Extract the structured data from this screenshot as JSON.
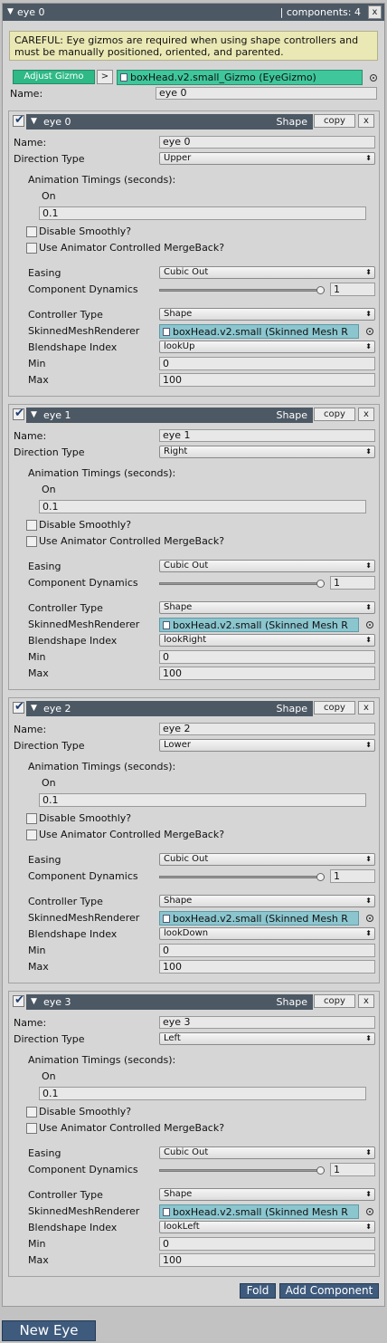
{
  "header": {
    "title": "eye 0",
    "components_label": "| components: 4",
    "close_glyph": "x"
  },
  "warning": {
    "line1": "CAREFUL: Eye gizmos are required when using shape controllers and",
    "line2": "must be manually positioned, oriented, and parented."
  },
  "gizmo": {
    "adjust_label": "Adjust Gizmo",
    "arrow_label": ">",
    "object_value": "boxHead.v2.small_Gizmo (EyeGizmo)"
  },
  "top_name": {
    "label": "Name:",
    "value": "eye 0"
  },
  "labels": {
    "name": "Name:",
    "direction": "Direction Type",
    "timings": "Animation Timings (seconds):",
    "on": "On",
    "disable_smoothly": "Disable Smoothly?",
    "use_animator": "Use Animator Controlled MergeBack?",
    "easing": "Easing",
    "dynamics": "Component Dynamics",
    "controller_type": "Controller Type",
    "smr": "SkinnedMeshRenderer",
    "blendshape": "Blendshape Index",
    "min": "Min",
    "max": "Max",
    "shape": "Shape",
    "copy": "copy",
    "x": "x"
  },
  "eyes": [
    {
      "title": "eye 0",
      "name": "eye 0",
      "direction": "Upper",
      "on": "0.1",
      "easing": "Cubic Out",
      "dynamics": "1",
      "dynamics_level": 1.0,
      "controller": "Shape",
      "smr": "boxHead.v2.small (Skinned Mesh R",
      "blendshape": "lookUp",
      "min": "0",
      "max": "100"
    },
    {
      "title": "eye 1",
      "name": "eye 1",
      "direction": "Right",
      "on": "0.1",
      "easing": "Cubic Out",
      "dynamics": "1",
      "dynamics_level": 1.0,
      "controller": "Shape",
      "smr": "boxHead.v2.small (Skinned Mesh R",
      "blendshape": "lookRight",
      "min": "0",
      "max": "100"
    },
    {
      "title": "eye 2",
      "name": "eye 2",
      "direction": "Lower",
      "on": "0.1",
      "easing": "Cubic Out",
      "dynamics": "1",
      "dynamics_level": 1.0,
      "controller": "Shape",
      "smr": "boxHead.v2.small (Skinned Mesh R",
      "blendshape": "lookDown",
      "min": "0",
      "max": "100"
    },
    {
      "title": "eye 3",
      "name": "eye 3",
      "direction": "Left",
      "on": "0.1",
      "easing": "Cubic Out",
      "dynamics": "1",
      "dynamics_level": 1.0,
      "controller": "Shape",
      "smr": "boxHead.v2.small (Skinned Mesh R",
      "blendshape": "lookLeft",
      "min": "0",
      "max": "100"
    }
  ],
  "footer": {
    "fold_label": "Fold",
    "add_label": "Add Component",
    "new_eye_label": "New Eye"
  },
  "colors": {
    "header_bg": "#4c5864",
    "gizmo_green": "#2fb987",
    "object_field_blue": "#8bc6cf",
    "button_blue": "#3e5a7c",
    "warning_bg": "#eae8b4"
  }
}
